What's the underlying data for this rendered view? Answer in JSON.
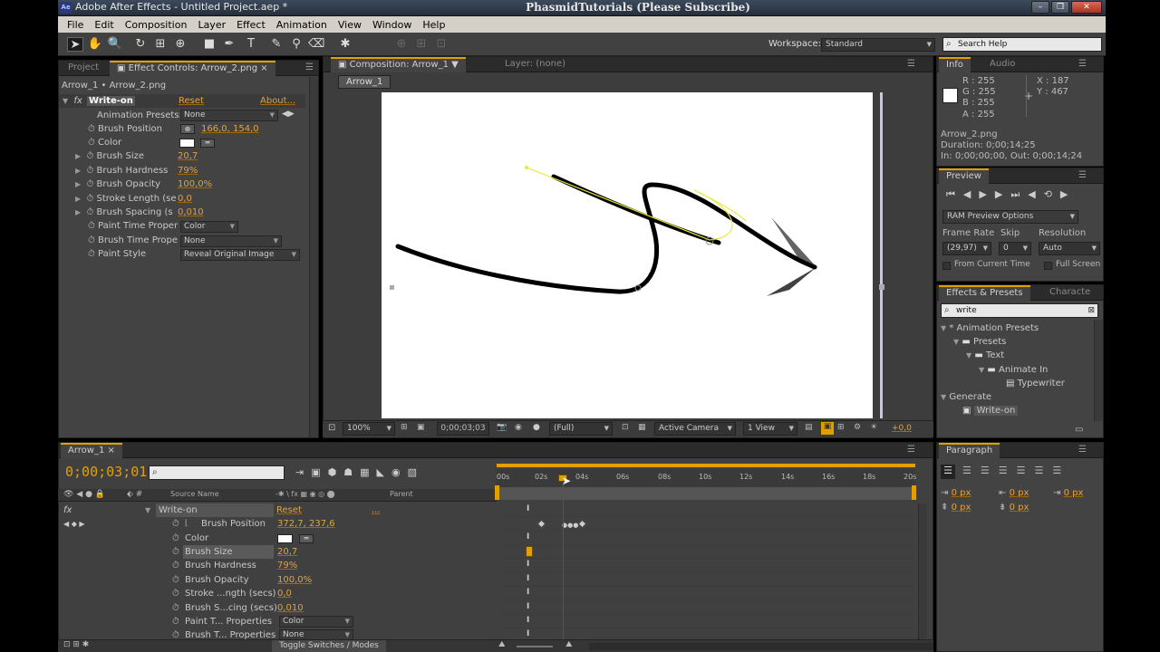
{
  "window": {
    "app_title": "Adobe After Effects - Untitled Project.aep *",
    "center_title": "PhasmidTutorials (Please Subscribe)",
    "logo": "Ae"
  },
  "menu": [
    "File",
    "Edit",
    "Composition",
    "Layer",
    "Effect",
    "Animation",
    "View",
    "Window",
    "Help"
  ],
  "toolbar": {
    "workspace_label": "Workspace:",
    "workspace_value": "Standard",
    "search_placeholder": "Search Help"
  },
  "effect_panel": {
    "tab_project": "Project",
    "tab_effect_controls": "Effect Controls: Arrow_2.png",
    "breadcrumb": "Arrow_1 • Arrow_2.png",
    "effect_name": "Write-on",
    "reset": "Reset",
    "about": "About...",
    "fx": "fx",
    "animation_presets_label": "Animation Presets:",
    "animation_presets_value": "None",
    "props": [
      {
        "label": "Brush Position",
        "value": "166,0, 154,0"
      },
      {
        "label": "Color",
        "value": ""
      },
      {
        "label": "Brush Size",
        "value": "20,7"
      },
      {
        "label": "Brush Hardness",
        "value": "79%"
      },
      {
        "label": "Brush Opacity",
        "value": "100,0%"
      },
      {
        "label": "Stroke Length (se",
        "value": "0,0"
      },
      {
        "label": "Brush Spacing (s",
        "value": "0,010"
      },
      {
        "label": "Paint Time Proper",
        "value": "Color"
      },
      {
        "label": "Brush Time Prope",
        "value": "None"
      },
      {
        "label": "Paint Style",
        "value": "Reveal Original Image"
      }
    ]
  },
  "composition": {
    "tab": "Composition: Arrow_1",
    "layer_tab": "Layer: (none)",
    "comp_button": "Arrow_1",
    "zoom": "100%",
    "timecode": "0;00;03;03",
    "resolution": "(Full)",
    "camera": "Active Camera",
    "view": "1 View",
    "exposure": "+0,0"
  },
  "info": {
    "tab_info": "Info",
    "tab_audio": "Audio",
    "r": "R : 255",
    "g": "G : 255",
    "b": "B : 255",
    "a": "A : 255",
    "x": "X : 187",
    "y": "Y : 467",
    "file": "Arrow_2.png",
    "duration": "Duration: 0;00;14;25",
    "inout": "In: 0;00;00;00, Out: 0;00;14;24"
  },
  "preview": {
    "tab": "Preview",
    "ram_options": "RAM Preview Options",
    "frame_rate_label": "Frame Rate",
    "skip_label": "Skip",
    "resolution_label": "Resolution",
    "frame_rate": "(29,97)",
    "skip": "0",
    "resolution": "Auto",
    "from_current": "From Current Time",
    "full_screen": "Full Screen"
  },
  "effects_presets": {
    "tab": "Effects & Presets",
    "tab2": "Characte",
    "search_value": "write",
    "tree": [
      {
        "label": "* Animation Presets",
        "indent": 0
      },
      {
        "label": "Presets",
        "indent": 1
      },
      {
        "label": "Text",
        "indent": 2
      },
      {
        "label": "Animate In",
        "indent": 3
      },
      {
        "label": "Typewriter",
        "indent": 4
      },
      {
        "label": "Generate",
        "indent": 0
      },
      {
        "label": "Write-on",
        "indent": 1
      }
    ]
  },
  "paragraph": {
    "tab": "Paragraph",
    "v1": "0 px",
    "v2": "0 px",
    "v3": "0 px",
    "v4": "0 px",
    "v5": "0 px"
  },
  "timeline": {
    "tab": "Arrow_1",
    "timecode": "0;00;03;01",
    "source_name_header": "Source Name",
    "parent_header": "Parent",
    "toggle_label": "Toggle Switches / Modes",
    "ticks": [
      "00s",
      "02s",
      "04s",
      "06s",
      "08s",
      "10s",
      "12s",
      "14s",
      "16s",
      "18s",
      "20s"
    ],
    "effect_row": {
      "name": "Write-on",
      "reset": "Reset",
      "dots": "..."
    },
    "rows": [
      {
        "label": "Brush Position",
        "value": "372,7, 237,6"
      },
      {
        "label": "Color",
        "value": ""
      },
      {
        "label": "Brush Size",
        "value": "20,7"
      },
      {
        "label": "Brush Hardness",
        "value": "79%"
      },
      {
        "label": "Brush Opacity",
        "value": "100,0%"
      },
      {
        "label": "Stroke ...ngth (secs)",
        "value": "0,0"
      },
      {
        "label": "Brush S...cing (secs)",
        "value": "0,010"
      },
      {
        "label": "Paint T... Properties",
        "value": "Color"
      },
      {
        "label": "Brush T... Properties",
        "value": "None"
      }
    ]
  },
  "colors": {
    "accent": "#e2a000",
    "playhead": "#d22020",
    "path": "#e8e838"
  }
}
